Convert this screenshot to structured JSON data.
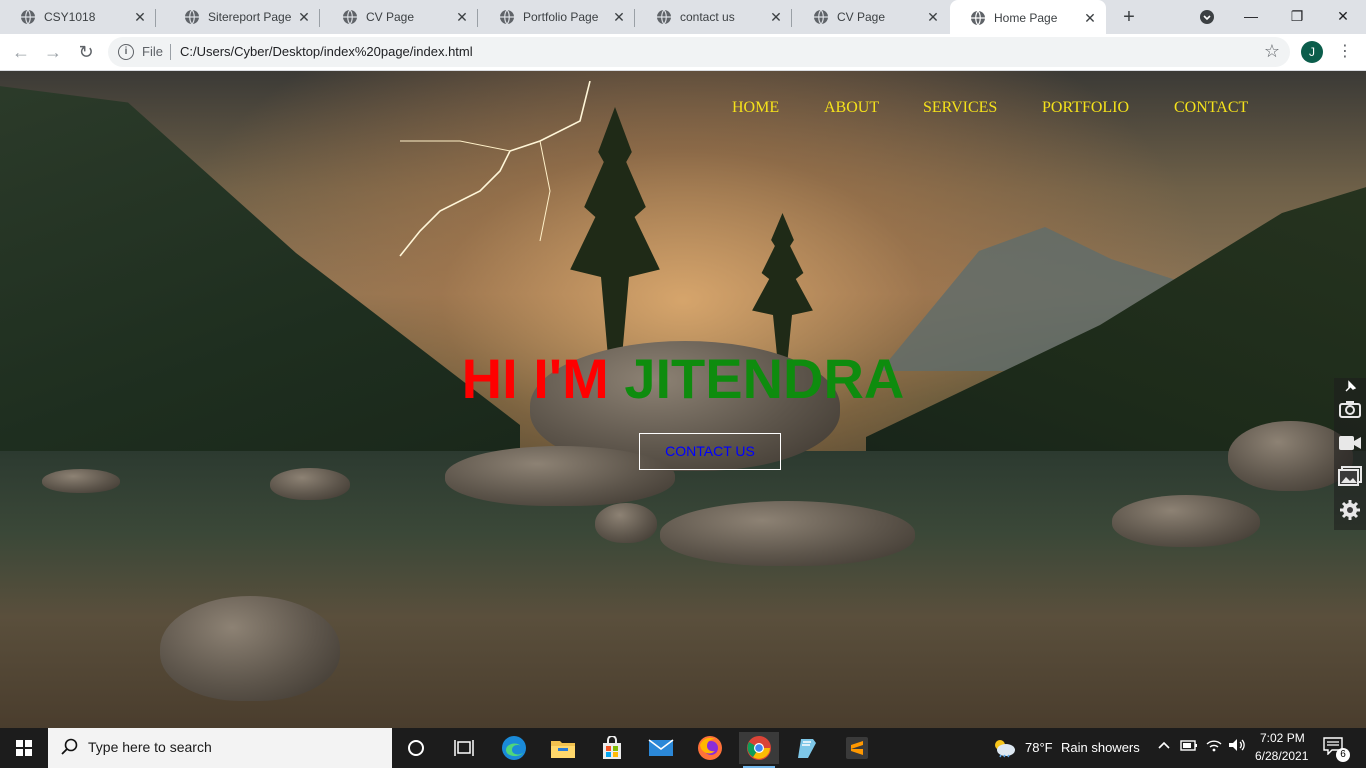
{
  "browser": {
    "tabs": [
      {
        "title": "CSY1018",
        "active": false
      },
      {
        "title": "Sitereport Page",
        "active": false
      },
      {
        "title": "CV Page",
        "active": false
      },
      {
        "title": "Portfolio Page",
        "active": false
      },
      {
        "title": "contact us",
        "active": false
      },
      {
        "title": "CV Page",
        "active": false
      },
      {
        "title": "Home Page",
        "active": true
      }
    ],
    "tab_close_glyph": "✕",
    "new_tab_glyph": "+",
    "window_controls": {
      "minimize": "—",
      "restore": "❐",
      "close": "✕"
    },
    "back_glyph": "←",
    "forward_glyph": "→",
    "reload_glyph": "↻",
    "info_glyph": "i",
    "file_label": "File",
    "url": "C:/Users/Cyber/Desktop/index%20page/index.html",
    "bookmark_glyph": "☆",
    "profile_initial": "J",
    "menu_glyph": "⋮"
  },
  "site": {
    "nav": [
      "HOME",
      "ABOUT",
      "SERVICES",
      "PORTFOLIO",
      "CONTACT"
    ],
    "hero_part1": "HI I'M",
    "hero_part2": "JITENDRA",
    "cta_label": "CONTACT US",
    "colors": {
      "nav": "#f5e21b",
      "hero_part1": "#ff0000",
      "hero_part2": "#0e8c0e",
      "cta_text": "#0000ff"
    }
  },
  "capture_toolbar": {
    "icons": [
      "pin-icon",
      "camera-icon",
      "video-icon",
      "gallery-icon",
      "settings-icon"
    ]
  },
  "taskbar": {
    "search_placeholder": "Type here to search",
    "apps": [
      "cortana-icon",
      "task-view-icon",
      "edge-icon",
      "file-explorer-icon",
      "store-icon",
      "mail-icon",
      "firefox-icon",
      "chrome-icon",
      "notepad-icon",
      "sublime-icon"
    ],
    "weather_temp": "78°F",
    "weather_text": "Rain showers",
    "time": "7:02 PM",
    "date": "6/28/2021",
    "notification_count": "6"
  }
}
